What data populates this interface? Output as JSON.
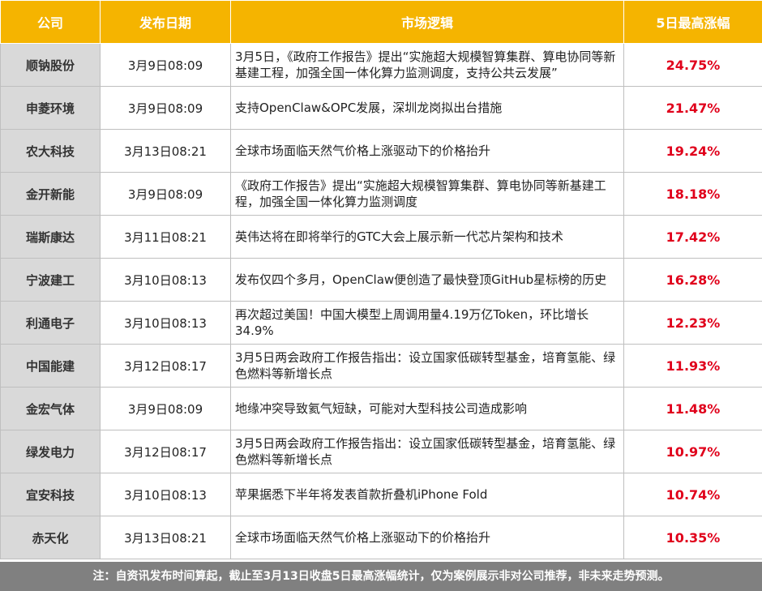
{
  "table": {
    "headers": [
      "公司",
      "发布日期",
      "市场逻辑",
      "5日最高涨幅"
    ],
    "rows": [
      {
        "company": "顺钠股份",
        "date": "3月9日08:09",
        "logic": "3月5日，《政府工作报告》提出“实施超大规模智算集群、算电协同等新基建工程，加强全国一体化算力监测调度，支持公共云发展”",
        "gain": "24.75%"
      },
      {
        "company": "申菱环境",
        "date": "3月9日08:09",
        "logic": "支持OpenClaw&OPC发展，深圳龙岗拟出台措施",
        "gain": "21.47%"
      },
      {
        "company": "农大科技",
        "date": "3月13日08:21",
        "logic": "全球市场面临天然气价格上涨驱动下的价格抬升",
        "gain": "19.24%"
      },
      {
        "company": "金开新能",
        "date": "3月9日08:09",
        "logic": "《政府工作报告》提出“实施超大规模智算集群、算电协同等新基建工程，加强全国一体化算力监测调度",
        "gain": "18.18%"
      },
      {
        "company": "瑞斯康达",
        "date": "3月11日08:21",
        "logic": "英伟达将在即将举行的GTC大会上展示新一代芯片架构和技术",
        "gain": "17.42%"
      },
      {
        "company": "宁波建工",
        "date": "3月10日08:13",
        "logic": "发布仅四个多月，OpenClaw便创造了最快登顶GitHub星标榜的历史",
        "gain": "16.28%"
      },
      {
        "company": "利通电子",
        "date": "3月10日08:13",
        "logic": "再次超过美国！中国大模型上周调用量4.19万亿Token，环比增长34.9%",
        "gain": "12.23%"
      },
      {
        "company": "中国能建",
        "date": "3月12日08:17",
        "logic": "3月5日两会政府工作报告指出：设立国家低碳转型基金，培育氢能、绿色燃料等新增长点",
        "gain": "11.93%"
      },
      {
        "company": "金宏气体",
        "date": "3月9日08:09",
        "logic": "地缘冲突导致氦气短缺，可能对大型科技公司造成影响",
        "gain": "11.48%"
      },
      {
        "company": "绿发电力",
        "date": "3月12日08:17",
        "logic": "3月5日两会政府工作报告指出：设立国家低碳转型基金，培育氢能、绿色燃料等新增长点",
        "gain": "10.97%"
      },
      {
        "company": "宜安科技",
        "date": "3月10日08:13",
        "logic": "苹果据悉下半年将发表首款折叠机iPhone Fold",
        "gain": "10.74%"
      },
      {
        "company": "赤天化",
        "date": "3月13日08:21",
        "logic": "全球市场面临天然气价格上涨驱动下的价格抬升",
        "gain": "10.35%"
      }
    ]
  },
  "footer": {
    "note": "注：自资讯发布时间算起，截止至3月13日收盘5日最高涨幅统计，仅为案例展示非对公司推荐，非未来走势预测。"
  },
  "colors": {
    "header_bg": "#f5b400",
    "company_bg": "#d9d9d9",
    "gain_text": "#e0001b",
    "footer_bg": "#808080"
  }
}
